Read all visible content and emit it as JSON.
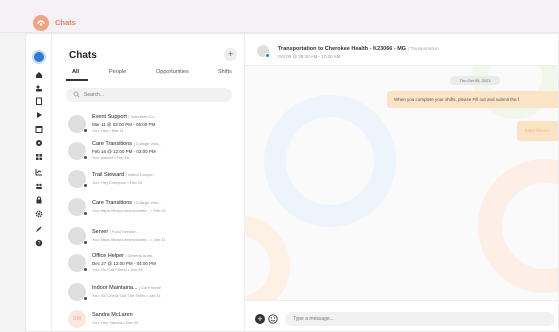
{
  "app": {
    "title": "Chats"
  },
  "rail": {
    "icons": [
      "globe-icon",
      "home-icon",
      "users-icon",
      "clipboard-icon",
      "play-icon",
      "calendar-icon",
      "location-icon",
      "grid-icon",
      "chart-icon",
      "people-icon",
      "lock-icon",
      "gear-icon",
      "edit-icon",
      "help-icon"
    ]
  },
  "panel": {
    "title": "Chats",
    "add_label": "+",
    "tabs": [
      {
        "label": "All",
        "active": true
      },
      {
        "label": "People",
        "active": false
      },
      {
        "label": "Opportunities",
        "active": false
      },
      {
        "label": "Shifts",
        "active": false
      }
    ],
    "search_placeholder": "Search...",
    "conversations": [
      {
        "name": "Event Support",
        "sub": "| Volunteer Co...",
        "time": "Mar 11 @ 03:00 PM - 05:00 PM",
        "preview": "You: Hey • Mar 11",
        "initials": ""
      },
      {
        "name": "Care Transitions",
        "sub": "| College Volu...",
        "time": "Feb 16 @ 12:00 PM - 03:00 PM",
        "preview": "You: Instant • Feb 16",
        "initials": ""
      },
      {
        "name": "Trail Steward",
        "sub": "| Island Canyon",
        "time": "",
        "preview": "You: Hey Everyone • Feb 03",
        "initials": ""
      },
      {
        "name": "Care Transitions",
        "sub": "| College Volu...",
        "time": "",
        "preview": "You: https://bravo.timesvolunte... • Feb 01",
        "initials": ""
      },
      {
        "name": "Server",
        "sub": "| Food Service...",
        "time": "",
        "preview": "You: https://bravo.timesvolunte... • Jan 31",
        "initials": ""
      },
      {
        "name": "Office Helper",
        "sub": "| General Admi...",
        "time": "Dec 27 @ 12:00 PM - 04:00 PM",
        "preview": "You: On Call Friend • Jan 23",
        "initials": ""
      },
      {
        "name": "Indoor Maintaina...",
        "sub": "| Care home",
        "time": "",
        "preview": "You: Go Check Out The Shifts • Jan 11",
        "initials": ""
      },
      {
        "name": "Sandra McLaren",
        "sub": "",
        "time": "",
        "preview": "You: Hey Sandra • Dec 20",
        "initials": "SM"
      }
    ]
  },
  "chat": {
    "title": "Transportation to Cherokee Health - K23066 - MG",
    "title_sub": "| Transportation",
    "subtitle": "Oct 09 @ 08:30 AM - 10:00 AM",
    "date_label": "Thu Oct 05, 2023",
    "messages": [
      {
        "text": "When you complete your shifts, please Fill out and submit the f"
      },
      {
        "text": "https://bravo"
      }
    ],
    "input_placeholder": "Type a message..."
  },
  "colors": {
    "brand": "#e8805a",
    "accent": "#2f7dd2",
    "bubble": "#fbe3c6"
  }
}
